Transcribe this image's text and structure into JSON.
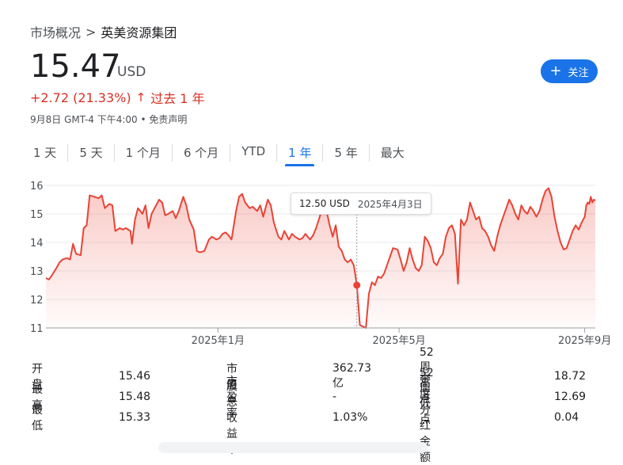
{
  "breadcrumb": {
    "parent": "市场概况",
    "separator": ">",
    "current": "英美资源集团"
  },
  "quote": {
    "price": "15.47",
    "currency": "USD",
    "change": "+2.72 (21.33%)",
    "change_arrow": "↑",
    "period": "过去 1 年",
    "meta": "9月8日 GMT-4 下午4:00 • 免责声明"
  },
  "follow_button": {
    "icon": "plus-icon",
    "label": "关注"
  },
  "tabs": [
    "1 天",
    "5 天",
    "1 个月",
    "6 个月",
    "YTD",
    "1 年",
    "5 年",
    "最大"
  ],
  "active_tab": "1 年",
  "tooltip": {
    "value": "12.50 USD",
    "date": "2025年4月3日"
  },
  "colors": {
    "line": "#ea4335",
    "accent": "#1a73e8",
    "negative": "#d93025"
  },
  "chart_data": {
    "type": "area",
    "y_ticks": [
      11,
      12,
      13,
      14,
      15,
      16
    ],
    "ylim": [
      11,
      16
    ],
    "x_tick_labels": [
      "2025年1月",
      "2025年5月",
      "2025年9月"
    ],
    "x_tick_dates": [
      "2025-01-01",
      "2025-05-01",
      "2025-09-01"
    ],
    "xlim": [
      "2024-09-09",
      "2025-09-08"
    ],
    "grid": true,
    "series": [
      {
        "values": [
          [
            "2024-09-09",
            12.75
          ],
          [
            "2024-09-11",
            12.7
          ],
          [
            "2024-09-13",
            12.85
          ],
          [
            "2024-09-16",
            13.1
          ],
          [
            "2024-09-18",
            13.3
          ],
          [
            "2024-09-20",
            13.4
          ],
          [
            "2024-09-23",
            13.45
          ],
          [
            "2024-09-25",
            13.4
          ],
          [
            "2024-09-27",
            13.95
          ],
          [
            "2024-09-29",
            13.6
          ],
          [
            "2024-10-02",
            13.55
          ],
          [
            "2024-10-04",
            14.5
          ],
          [
            "2024-10-06",
            14.6
          ],
          [
            "2024-10-08",
            15.65
          ],
          [
            "2024-10-11",
            15.6
          ],
          [
            "2024-10-14",
            15.55
          ],
          [
            "2024-10-16",
            15.65
          ],
          [
            "2024-10-18",
            15.2
          ],
          [
            "2024-10-21",
            15.35
          ],
          [
            "2024-10-23",
            15.3
          ],
          [
            "2024-10-25",
            14.4
          ],
          [
            "2024-10-28",
            14.5
          ],
          [
            "2024-10-30",
            14.45
          ],
          [
            "2024-11-01",
            14.5
          ],
          [
            "2024-11-04",
            14.4
          ],
          [
            "2024-11-05",
            13.95
          ],
          [
            "2024-11-07",
            14.8
          ],
          [
            "2024-11-09",
            15.2
          ],
          [
            "2024-11-12",
            15.0
          ],
          [
            "2024-11-14",
            15.3
          ],
          [
            "2024-11-16",
            14.5
          ],
          [
            "2024-11-18",
            15.0
          ],
          [
            "2024-11-21",
            15.3
          ],
          [
            "2024-11-23",
            15.5
          ],
          [
            "2024-11-25",
            15.4
          ],
          [
            "2024-11-27",
            14.95
          ],
          [
            "2024-11-29",
            15.0
          ],
          [
            "2024-12-02",
            15.1
          ],
          [
            "2024-12-04",
            14.85
          ],
          [
            "2024-12-06",
            15.1
          ],
          [
            "2024-12-09",
            15.6
          ],
          [
            "2024-12-11",
            15.3
          ],
          [
            "2024-12-13",
            14.8
          ],
          [
            "2024-12-16",
            14.45
          ],
          [
            "2024-12-18",
            13.7
          ],
          [
            "2024-12-20",
            13.65
          ],
          [
            "2024-12-23",
            13.7
          ],
          [
            "2024-12-26",
            14.1
          ],
          [
            "2024-12-28",
            14.2
          ],
          [
            "2024-12-31",
            14.1
          ],
          [
            "2025-01-02",
            14.15
          ],
          [
            "2025-01-04",
            14.3
          ],
          [
            "2025-01-06",
            14.35
          ],
          [
            "2025-01-08",
            14.25
          ],
          [
            "2025-01-10",
            14.1
          ],
          [
            "2025-01-13",
            15.1
          ],
          [
            "2025-01-15",
            15.6
          ],
          [
            "2025-01-17",
            15.7
          ],
          [
            "2025-01-19",
            15.4
          ],
          [
            "2025-01-22",
            15.2
          ],
          [
            "2025-01-24",
            15.25
          ],
          [
            "2025-01-27",
            15.1
          ],
          [
            "2025-01-29",
            15.3
          ],
          [
            "2025-01-31",
            14.9
          ],
          [
            "2025-02-03",
            15.5
          ],
          [
            "2025-02-05",
            15.3
          ],
          [
            "2025-02-07",
            14.7
          ],
          [
            "2025-02-10",
            14.2
          ],
          [
            "2025-02-12",
            14.1
          ],
          [
            "2025-02-14",
            14.4
          ],
          [
            "2025-02-17",
            14.1
          ],
          [
            "2025-02-19",
            14.3
          ],
          [
            "2025-02-21",
            14.2
          ],
          [
            "2025-02-24",
            14.1
          ],
          [
            "2025-02-26",
            14.15
          ],
          [
            "2025-02-28",
            14.3
          ],
          [
            "2025-03-03",
            14.1
          ],
          [
            "2025-03-05",
            14.25
          ],
          [
            "2025-03-07",
            14.5
          ],
          [
            "2025-03-10",
            15.0
          ],
          [
            "2025-03-12",
            15.2
          ],
          [
            "2025-03-14",
            15.1
          ],
          [
            "2025-03-16",
            14.6
          ],
          [
            "2025-03-18",
            14.2
          ],
          [
            "2025-03-20",
            14.6
          ],
          [
            "2025-03-22",
            13.85
          ],
          [
            "2025-03-24",
            13.7
          ],
          [
            "2025-03-26",
            13.4
          ],
          [
            "2025-03-28",
            13.3
          ],
          [
            "2025-03-30",
            13.4
          ],
          [
            "2025-04-01",
            13.2
          ],
          [
            "2025-04-03",
            12.5
          ],
          [
            "2025-04-05",
            11.1
          ],
          [
            "2025-04-07",
            11.05
          ],
          [
            "2025-04-09",
            11.0
          ],
          [
            "2025-04-11",
            12.2
          ],
          [
            "2025-04-13",
            12.6
          ],
          [
            "2025-04-15",
            12.5
          ],
          [
            "2025-04-17",
            12.8
          ],
          [
            "2025-04-19",
            12.75
          ],
          [
            "2025-04-21",
            12.9
          ],
          [
            "2025-04-23",
            13.2
          ],
          [
            "2025-04-25",
            13.5
          ],
          [
            "2025-04-27",
            13.8
          ],
          [
            "2025-04-30",
            13.75
          ],
          [
            "2025-05-02",
            13.4
          ],
          [
            "2025-05-04",
            13.0
          ],
          [
            "2025-05-06",
            13.3
          ],
          [
            "2025-05-08",
            13.8
          ],
          [
            "2025-05-10",
            13.4
          ],
          [
            "2025-05-12",
            13.1
          ],
          [
            "2025-05-14",
            13.0
          ],
          [
            "2025-05-16",
            13.2
          ],
          [
            "2025-05-18",
            14.2
          ],
          [
            "2025-05-20",
            14.05
          ],
          [
            "2025-05-22",
            13.8
          ],
          [
            "2025-05-24",
            13.3
          ],
          [
            "2025-05-26",
            13.2
          ],
          [
            "2025-05-28",
            13.45
          ],
          [
            "2025-05-30",
            13.6
          ],
          [
            "2025-06-01",
            14.2
          ],
          [
            "2025-06-03",
            14.5
          ],
          [
            "2025-06-05",
            14.6
          ],
          [
            "2025-06-07",
            14.3
          ],
          [
            "2025-06-09",
            12.55
          ],
          [
            "2025-06-11",
            14.8
          ],
          [
            "2025-06-13",
            14.6
          ],
          [
            "2025-06-15",
            14.8
          ],
          [
            "2025-06-17",
            15.4
          ],
          [
            "2025-06-19",
            15.1
          ],
          [
            "2025-06-21",
            14.8
          ],
          [
            "2025-06-23",
            14.9
          ],
          [
            "2025-06-25",
            14.5
          ],
          [
            "2025-06-27",
            14.4
          ],
          [
            "2025-06-29",
            14.2
          ],
          [
            "2025-07-01",
            13.9
          ],
          [
            "2025-07-03",
            13.7
          ],
          [
            "2025-07-05",
            14.2
          ],
          [
            "2025-07-07",
            14.6
          ],
          [
            "2025-07-09",
            14.9
          ],
          [
            "2025-07-11",
            15.2
          ],
          [
            "2025-07-13",
            15.5
          ],
          [
            "2025-07-15",
            15.3
          ],
          [
            "2025-07-17",
            15.0
          ],
          [
            "2025-07-19",
            14.8
          ],
          [
            "2025-07-21",
            15.3
          ],
          [
            "2025-07-23",
            15.1
          ],
          [
            "2025-07-25",
            15.0
          ],
          [
            "2025-07-27",
            15.25
          ],
          [
            "2025-07-29",
            15.1
          ],
          [
            "2025-07-31",
            14.9
          ],
          [
            "2025-08-02",
            15.1
          ],
          [
            "2025-08-04",
            15.5
          ],
          [
            "2025-08-06",
            15.8
          ],
          [
            "2025-08-08",
            15.9
          ],
          [
            "2025-08-10",
            15.6
          ],
          [
            "2025-08-12",
            14.9
          ],
          [
            "2025-08-14",
            14.4
          ],
          [
            "2025-08-16",
            14.0
          ],
          [
            "2025-08-18",
            13.75
          ],
          [
            "2025-08-20",
            13.8
          ],
          [
            "2025-08-22",
            14.1
          ],
          [
            "2025-08-24",
            14.4
          ],
          [
            "2025-08-26",
            14.6
          ],
          [
            "2025-08-28",
            14.45
          ],
          [
            "2025-08-30",
            14.7
          ],
          [
            "2025-09-01",
            14.9
          ],
          [
            "2025-09-02",
            15.3
          ],
          [
            "2025-09-03",
            15.4
          ],
          [
            "2025-09-04",
            15.35
          ],
          [
            "2025-09-05",
            15.6
          ],
          [
            "2025-09-06",
            15.4
          ],
          [
            "2025-09-07",
            15.5
          ],
          [
            "2025-09-08",
            15.47
          ]
        ]
      }
    ],
    "highlight": {
      "date": "2025-04-03",
      "value": 12.5
    }
  },
  "stats": {
    "col1": [
      {
        "label": "开盘",
        "value": "15.46"
      },
      {
        "label": "最高",
        "value": "15.48"
      },
      {
        "label": "最低",
        "value": "15.33"
      }
    ],
    "col2": [
      {
        "label": "市值",
        "value": "362.73亿"
      },
      {
        "label": "市盈率",
        "value": "-"
      },
      {
        "label": "股息收益率",
        "value": "1.03%"
      }
    ],
    "col3": [
      {
        "label": "52 周高点",
        "value": "18.72"
      },
      {
        "label": "52 周低点",
        "value": "12.69"
      },
      {
        "label": "季度分红金额",
        "value": "0.04"
      }
    ]
  }
}
